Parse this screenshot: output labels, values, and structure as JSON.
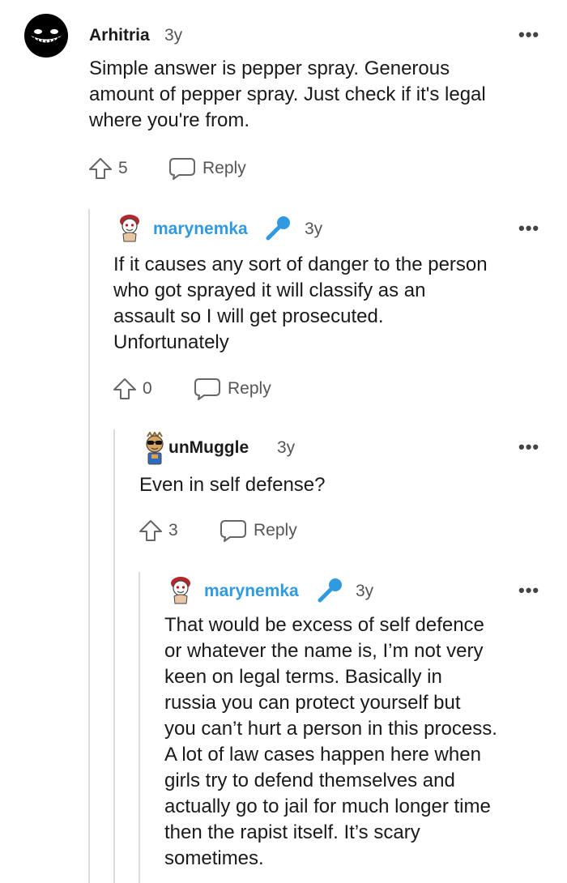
{
  "comments": [
    {
      "username": "Arhitria",
      "age": "3y",
      "text": "Simple answer is pepper spray. Generous amount of pepper spray. Just check if it's legal where you're from.",
      "lines": [
        "Simple answer is pepper spray. Generous",
        "amount of pepper spray. Just check if it's legal",
        "where you're from."
      ],
      "votes": "5",
      "reply_label": "Reply",
      "avatar_icon": "grinning-shadow-avatar-icon"
    },
    {
      "username": "marynemka",
      "age": "3y",
      "is_op": true,
      "badge_icon": "microphone-icon",
      "lines": [
        "If it causes any sort of danger to the person",
        "who got sprayed it will classify as an",
        "assault so I will get prosecuted.",
        "Unfortunately"
      ],
      "votes": "0",
      "reply_label": "Reply",
      "avatar_icon": "snoo-avatar-icon"
    },
    {
      "username": "unMuggle",
      "age": "3y",
      "lines": [
        "Even in self defense?"
      ],
      "votes": "3",
      "reply_label": "Reply",
      "avatar_icon": "snoo-sunglasses-avatar-icon"
    },
    {
      "username": "marynemka",
      "age": "3y",
      "is_op": true,
      "badge_icon": "microphone-icon",
      "lines": [
        "That would be excess of self defence",
        "or whatever the name is, I’m not very",
        "keen on legal terms. Basically in",
        "russia you can protect yourself but",
        "you can’t hurt a person in this process.",
        "A lot of law cases happen here when",
        "girls try to defend themselves and",
        "actually go to jail for much longer time",
        "then the rapist itself. It’s scary",
        "sometimes."
      ],
      "avatar_icon": "snoo-avatar-icon"
    }
  ],
  "more_glyph": "•••",
  "colors": {
    "op_username": "#2f9ae0",
    "thread_line": "#dcdcdc",
    "text": "#1a1a1b",
    "muted": "#555555"
  }
}
